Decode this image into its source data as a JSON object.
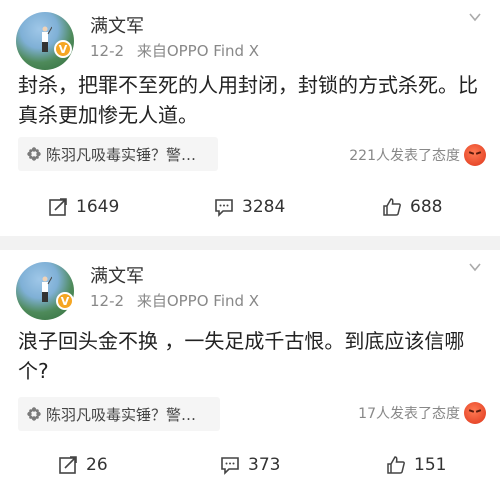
{
  "posts": [
    {
      "username": "满文军",
      "date": "12-2",
      "source": "来自OPPO Find X",
      "content_line1": "封杀，把罪不至死的人用封闭，封锁的方式杀死。比",
      "content_line2": "真杀更加惨无人道。",
      "topic": "陈羽凡吸毒实锤？警…",
      "reaction_text": "221人发表了态度",
      "reaction_icon": "angry-emoji-icon",
      "repost_count": "1649",
      "comment_count": "3284",
      "like_count": "688"
    },
    {
      "username": "满文军",
      "date": "12-2",
      "source": "来自OPPO Find X",
      "content_line1": "浪子回头金不换 ，一失足成千古恨。到底应该信哪",
      "content_line2": "个?",
      "topic": "陈羽凡吸毒实锤？警…",
      "reaction_text": "17人发表了态度",
      "reaction_icon": "angry-emoji-icon",
      "repost_count": "26",
      "comment_count": "373",
      "like_count": "151"
    }
  ],
  "colors": {
    "badge": "#f5a623",
    "separator": "#f2f2f2",
    "chip_bg": "#f5f5f5"
  }
}
